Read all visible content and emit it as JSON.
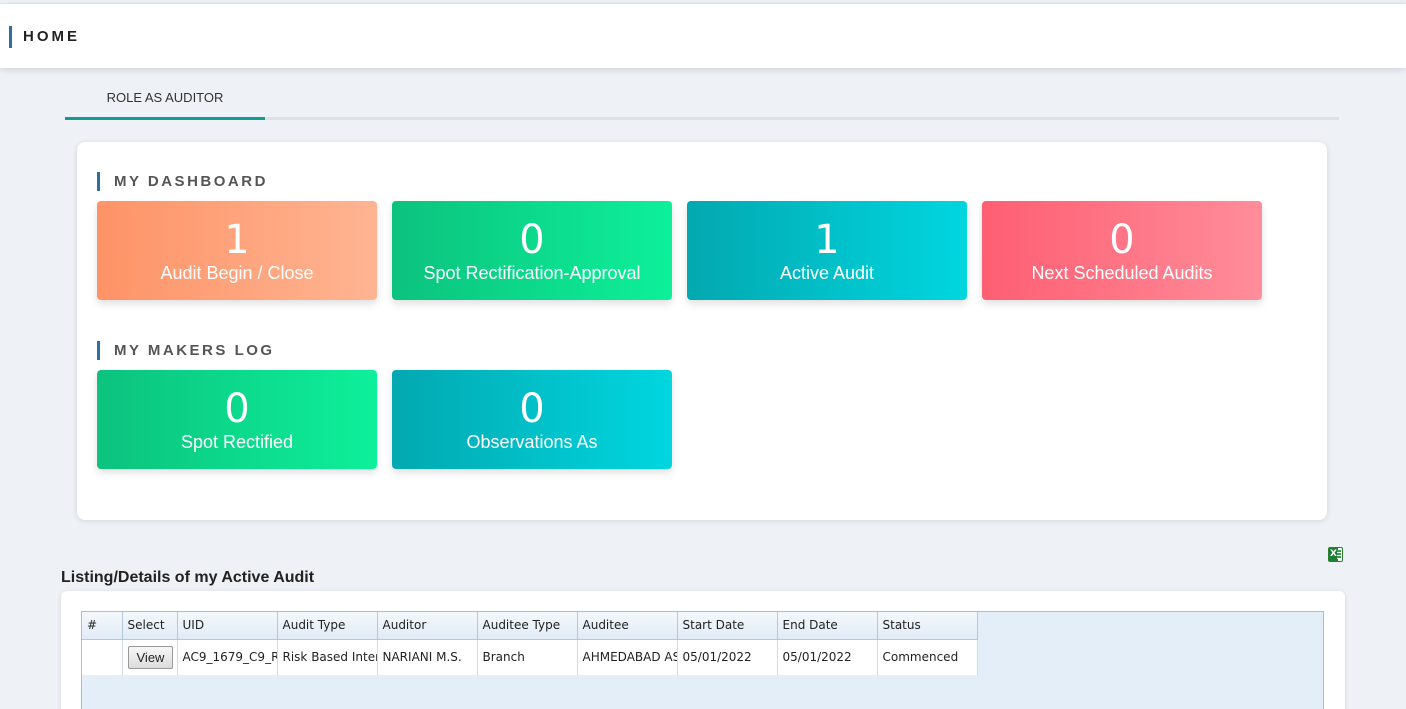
{
  "header": {
    "title": "HOME"
  },
  "tabs": [
    {
      "label": "ROLE AS AUDITOR",
      "active": true
    }
  ],
  "dashboard": {
    "title": "MY DASHBOARD",
    "cards": [
      {
        "value": "1",
        "label": "Audit Begin / Close",
        "color": "#fe9367"
      },
      {
        "value": "0",
        "label": "Spot Rectification-Approval",
        "color": "#0cc27e"
      },
      {
        "value": "1",
        "label": "Active Audit",
        "color": "#03a8b0"
      },
      {
        "value": "0",
        "label": "Next Scheduled Audits",
        "color": "#fe5e72"
      }
    ]
  },
  "makers_log": {
    "title": "MY MAKERS LOG",
    "cards": [
      {
        "value": "0",
        "label": "Spot Rectified",
        "color": "#0cc27e"
      },
      {
        "value": "0",
        "label": "Observations As",
        "color": "#03a8b0"
      }
    ]
  },
  "export": {
    "icon": "excel-export-icon"
  },
  "listing": {
    "heading": "Listing/Details of my Active Audit",
    "columns": [
      "#",
      "Select",
      "UID",
      "Audit Type",
      "Auditor",
      "Auditee Type",
      "Auditee",
      "Start Date",
      "End Date",
      "Status"
    ],
    "rows": [
      {
        "index": "",
        "select_label": "View",
        "uid": "AC9_1679_C9_R",
        "audit_type": "Risk Based Interi",
        "auditor": "NARIANI M.S.",
        "auditee_type": "Branch",
        "auditee": "AHMEDABAD ASI",
        "start_date": "05/01/2022",
        "end_date": "05/01/2022",
        "status": "Commenced"
      }
    ]
  }
}
